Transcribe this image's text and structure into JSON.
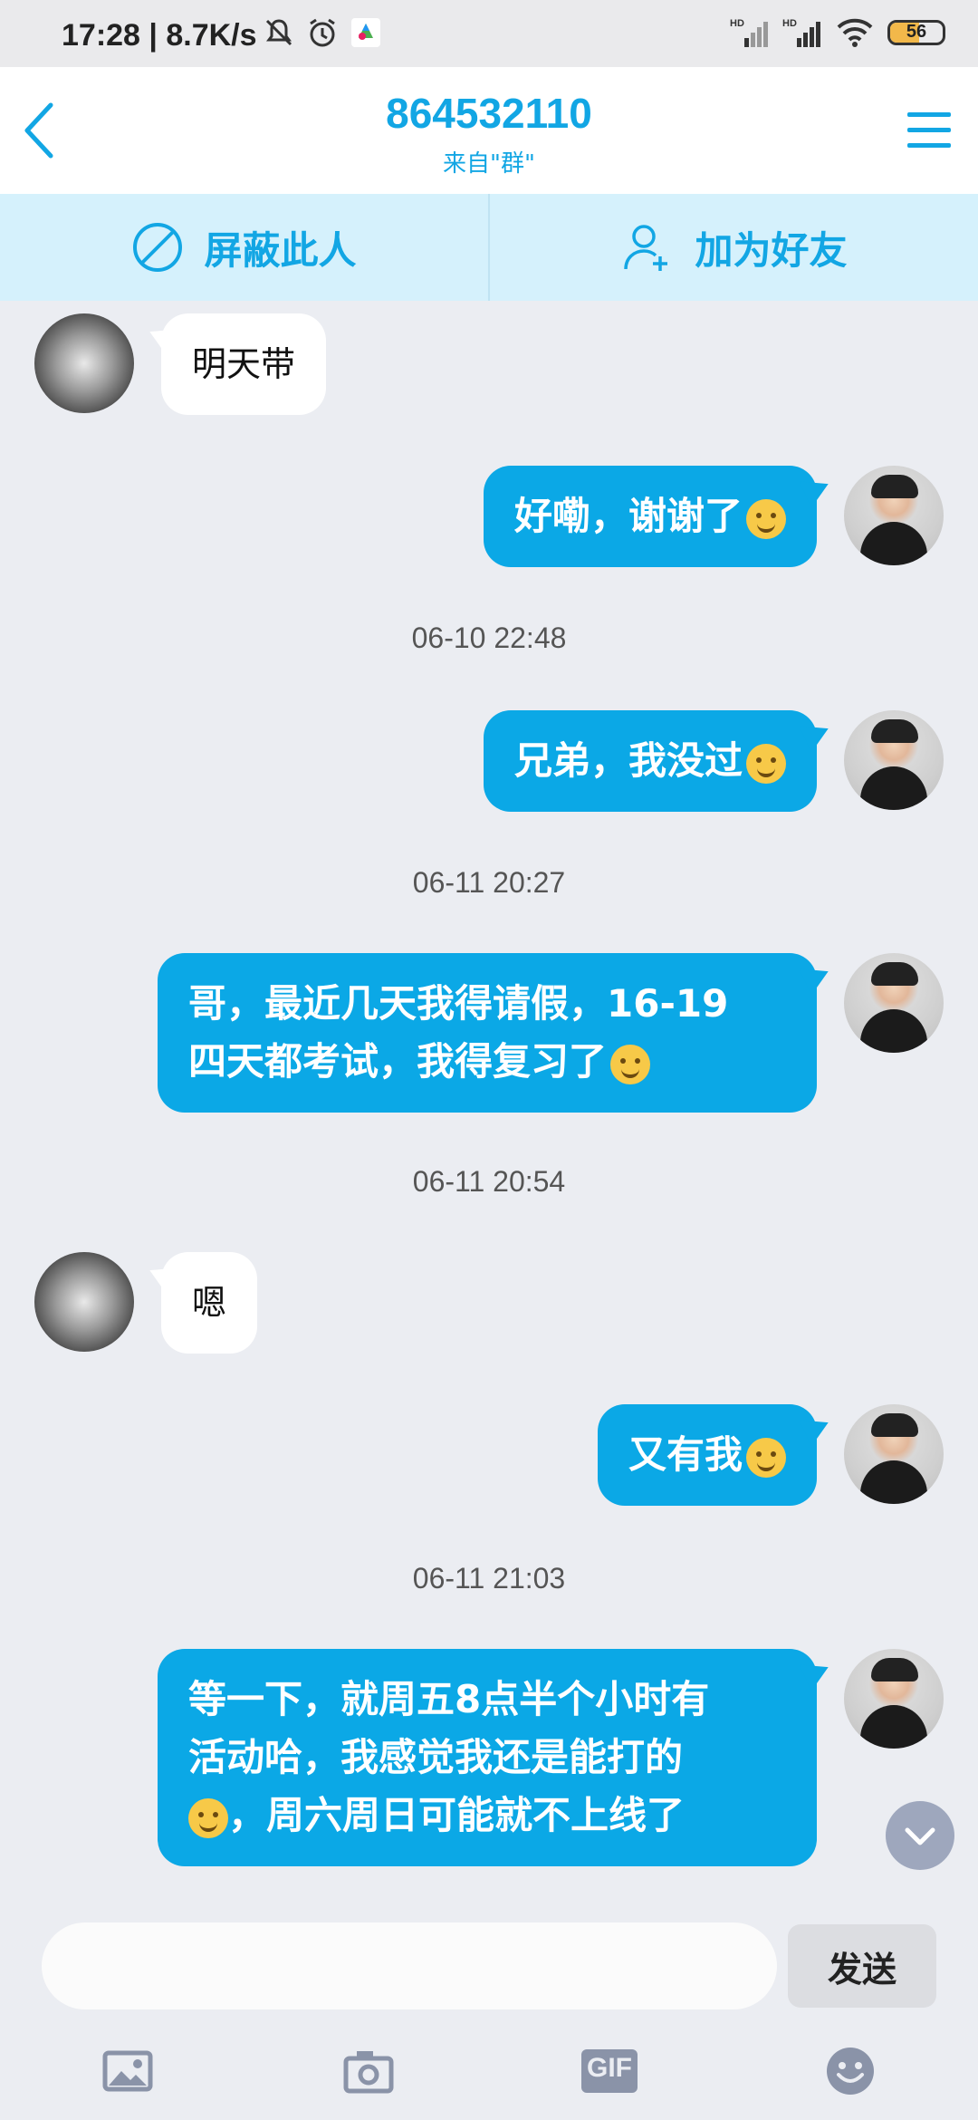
{
  "status_bar": {
    "time_speed": "17:28 | 8.7K/s",
    "battery": "56",
    "battery_level": 0.56,
    "signal1_label": "HD",
    "signal2_label": "HD"
  },
  "header": {
    "title": "864532110",
    "subtitle": "来自\"群\""
  },
  "actions": {
    "block_label": "屏蔽此人",
    "add_friend_label": "加为好友"
  },
  "messages": [
    {
      "from": "other",
      "text": "明天带"
    },
    {
      "from": "me",
      "text": "好嘞，谢谢了",
      "emoji": "ok-hand-emoji"
    },
    {
      "type": "timestamp",
      "text": "06-10 22:48"
    },
    {
      "from": "me",
      "text": "兄弟，我没过",
      "emoji": "grin-emoji"
    },
    {
      "type": "timestamp",
      "text": "06-11 20:27"
    },
    {
      "from": "me",
      "text_line1": "哥，最近几天我得请假，16-19",
      "text_line2": "四天都考试，我得复习了",
      "emoji": "cry-emoji"
    },
    {
      "type": "timestamp",
      "text": "06-11 20:54"
    },
    {
      "from": "other",
      "text": "嗯"
    },
    {
      "from": "me",
      "text": "又有我",
      "emoji": "awkward-emoji"
    },
    {
      "type": "timestamp",
      "text": "06-11 21:03"
    },
    {
      "from": "me",
      "text_line1": "等一下，就周五8点半个小时有",
      "text_line2": "活动哈，我感觉我还是能打的",
      "text_line3": "，周六周日可能就不上线了",
      "emoji": "awkward-emoji"
    }
  ],
  "input": {
    "placeholder": "",
    "value": "",
    "send_label": "发送"
  },
  "toolbar": {
    "gif_label": "GIF"
  },
  "colors": {
    "accent": "#12a6e4",
    "bubble_me": "#0ba8e6",
    "action_bar": "#d5f1fc",
    "background": "#ebedf2"
  }
}
